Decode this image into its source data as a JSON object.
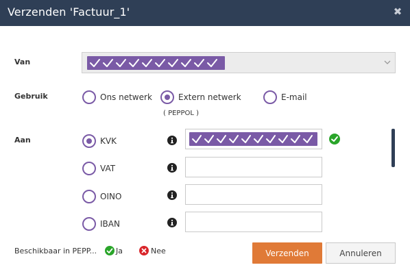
{
  "dialog": {
    "title": "Verzenden 'Factuur_1'",
    "close_icon": "close-icon"
  },
  "van": {
    "label": "Van",
    "masked_count": 10,
    "chevron_icon": "chevron-down-icon"
  },
  "gebruik": {
    "label": "Gebruik",
    "options": [
      {
        "label": "Ons netwerk",
        "selected": false
      },
      {
        "label": "Extern netwerk",
        "selected": true
      },
      {
        "label": "E-mail",
        "selected": false
      }
    ],
    "note": "( PEPPOL )"
  },
  "aan": {
    "label": "Aan",
    "rows": [
      {
        "label": "KVK",
        "selected": true,
        "info_icon": "info-icon",
        "masked_count": 10,
        "valid": true
      },
      {
        "label": "VAT",
        "selected": false,
        "info_icon": "info-icon",
        "value": ""
      },
      {
        "label": "OINO",
        "selected": false,
        "info_icon": "info-icon",
        "value": ""
      },
      {
        "label": "IBAN",
        "selected": false,
        "info_icon": "info-icon",
        "value": ""
      }
    ]
  },
  "footer": {
    "available_label": "Beschikbaar in PEPP...",
    "yes_label": "Ja",
    "no_label": "Nee",
    "send_label": "Verzenden",
    "cancel_label": "Annuleren"
  },
  "colors": {
    "titlebar": "#2f3f56",
    "accent": "#7a5aa6",
    "primary_button": "#e07a37",
    "ok": "#2aa52a",
    "error": "#d9252a"
  }
}
